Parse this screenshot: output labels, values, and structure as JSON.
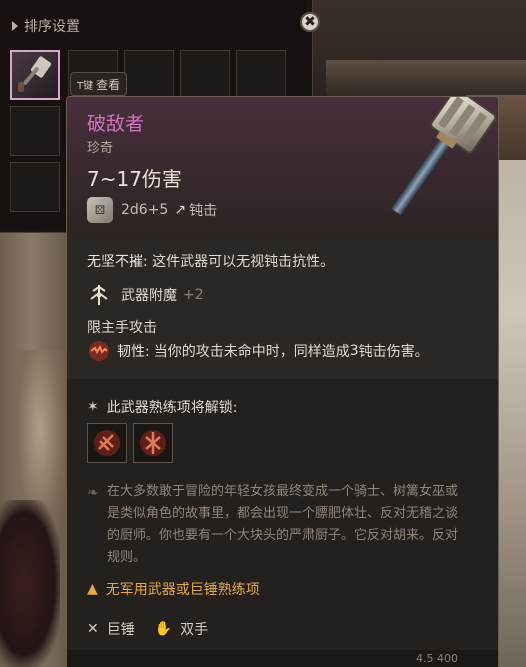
{
  "sort_panel": {
    "title": "排序设置",
    "close_symbol": "✖",
    "key_hint": {
      "key": "T键",
      "label": "查看"
    }
  },
  "item": {
    "name": "破敌者",
    "rarity": "珍奇",
    "damage": "7~17伤害",
    "dice": "2d6+5",
    "damage_type": "钝击",
    "passive": {
      "name": "无坚不摧:",
      "desc": "这件武器可以无视钝击抗性。"
    },
    "enchant": {
      "label": "武器附魔",
      "value": "+2"
    },
    "restriction": "限主手攻击",
    "tenacity": {
      "name": "韧性:",
      "desc_prefix": "当你的攻击未命中时，同样造成",
      "amount": "3",
      "desc_suffix": "钝击伤害。"
    },
    "proficiency_header": "此武器熟练项将解锁:",
    "lore": "在大多数敢于冒险的年轻女孩最终变成一个骑士、树篱女巫或是类似角色的故事里，都会出现一个膘肥体壮、反对无稽之谈的厨师。你也要有一个大块头的严肃厨子。它反对胡来。反对规则。",
    "warning": "无军用武器或巨锤熟练项",
    "tags": [
      "巨锤",
      "双手"
    ],
    "footer_value": "4.5  400"
  },
  "colors": {
    "title": "#d66fc6",
    "warning": "#e2a94a",
    "text": "#e3dace",
    "muted": "#8b8176"
  }
}
